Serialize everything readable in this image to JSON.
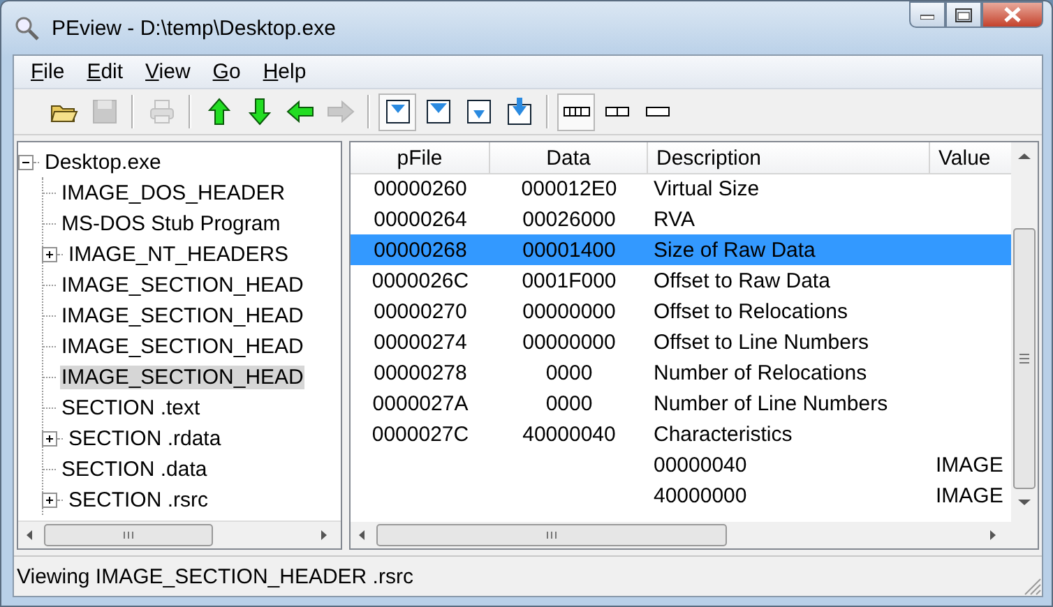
{
  "window": {
    "title": "PEview - D:\\temp\\Desktop.exe"
  },
  "menu": [
    "File",
    "Edit",
    "View",
    "Go",
    "Help"
  ],
  "toolbar": [
    {
      "kind": "open",
      "disabled": false,
      "pressed": false
    },
    {
      "kind": "save",
      "disabled": true,
      "pressed": false
    },
    {
      "kind": "sep"
    },
    {
      "kind": "print",
      "disabled": true,
      "pressed": false
    },
    {
      "kind": "sep"
    },
    {
      "kind": "up",
      "disabled": false,
      "pressed": false
    },
    {
      "kind": "down",
      "disabled": false,
      "pressed": false
    },
    {
      "kind": "back",
      "disabled": false,
      "pressed": false
    },
    {
      "kind": "forward",
      "disabled": true,
      "pressed": false
    },
    {
      "kind": "sep"
    },
    {
      "kind": "view1",
      "disabled": false,
      "pressed": true
    },
    {
      "kind": "view2",
      "disabled": false,
      "pressed": false
    },
    {
      "kind": "view3",
      "disabled": false,
      "pressed": false
    },
    {
      "kind": "view4",
      "disabled": false,
      "pressed": false
    },
    {
      "kind": "sep"
    },
    {
      "kind": "width1",
      "disabled": false,
      "pressed": true
    },
    {
      "kind": "width2",
      "disabled": false,
      "pressed": false
    },
    {
      "kind": "width3",
      "disabled": false,
      "pressed": false
    }
  ],
  "tree": [
    {
      "label": "Desktop.exe",
      "expanded": true,
      "selected": false,
      "children": [
        {
          "label": "IMAGE_DOS_HEADER",
          "selected": false
        },
        {
          "label": "MS-DOS Stub Program",
          "selected": false
        },
        {
          "label": "IMAGE_NT_HEADERS",
          "expanded": false,
          "selected": false
        },
        {
          "label": "IMAGE_SECTION_HEAD",
          "selected": false
        },
        {
          "label": "IMAGE_SECTION_HEAD",
          "selected": false
        },
        {
          "label": "IMAGE_SECTION_HEAD",
          "selected": false
        },
        {
          "label": "IMAGE_SECTION_HEAD",
          "selected": true
        },
        {
          "label": "SECTION .text",
          "selected": false
        },
        {
          "label": "SECTION .rdata",
          "expanded": false,
          "selected": false
        },
        {
          "label": "SECTION .data",
          "selected": false
        },
        {
          "label": "SECTION .rsrc",
          "expanded": false,
          "selected": false
        }
      ]
    }
  ],
  "table": {
    "columns": [
      "pFile",
      "Data",
      "Description",
      "Value"
    ],
    "rows": [
      {
        "pfile": "00000260",
        "data": "000012E0",
        "description": "Virtual Size",
        "selected": false
      },
      {
        "pfile": "00000264",
        "data": "00026000",
        "description": "RVA",
        "selected": false
      },
      {
        "pfile": "00000268",
        "data": "00001400",
        "description": "Size of Raw Data",
        "selected": true
      },
      {
        "pfile": "0000026C",
        "data": "0001F000",
        "description": "Offset to Raw Data",
        "selected": false
      },
      {
        "pfile": "00000270",
        "data": "00000000",
        "description": "Offset to Relocations",
        "selected": false
      },
      {
        "pfile": "00000274",
        "data": "00000000",
        "description": "Offset to Line Numbers",
        "selected": false
      },
      {
        "pfile": "00000278",
        "data": "0000",
        "description": "Number of Relocations",
        "selected": false
      },
      {
        "pfile": "0000027A",
        "data": "0000",
        "description": "Number of Line Numbers",
        "selected": false
      },
      {
        "pfile": "0000027C",
        "data": "40000040",
        "description": "Characteristics",
        "selected": false
      },
      {
        "description": "00000040",
        "value": "IMAGE",
        "selected": false
      },
      {
        "description": "40000000",
        "value": "IMAGE",
        "selected": false
      }
    ]
  },
  "status_bar": "Viewing IMAGE_SECTION_HEADER .rsrc"
}
